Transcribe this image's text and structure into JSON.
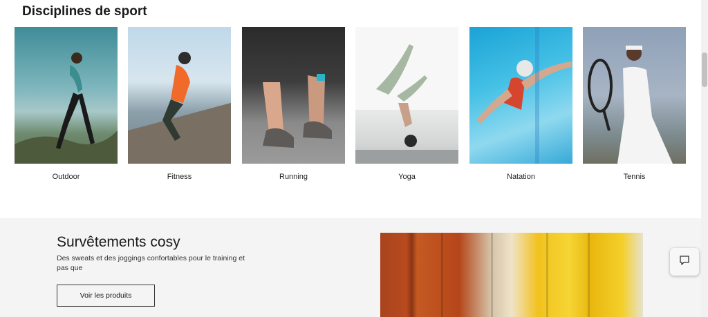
{
  "disciplines": {
    "title": "Disciplines de sport",
    "items": [
      {
        "label": "Outdoor"
      },
      {
        "label": "Fitness"
      },
      {
        "label": "Running"
      },
      {
        "label": "Yoga"
      },
      {
        "label": "Natation"
      },
      {
        "label": "Tennis"
      }
    ]
  },
  "promo": {
    "title": "Survêtements cosy",
    "description": "Des sweats et des joggings confortables pour le training et pas que",
    "button_label": "Voir les produits"
  },
  "chat": {
    "icon": "chat-bubble-icon"
  }
}
